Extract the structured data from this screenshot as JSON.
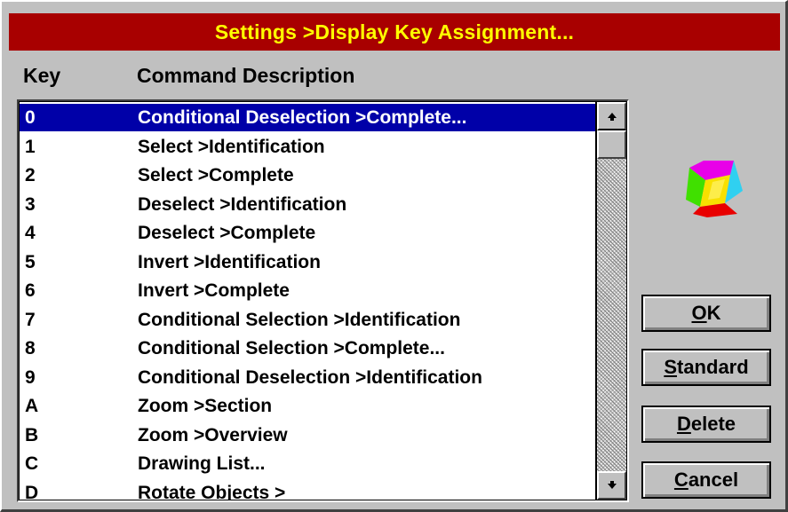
{
  "title": "Settings >Display Key Assignment...",
  "columns": {
    "key": "Key",
    "description": "Command Description"
  },
  "rows": [
    {
      "key": "0",
      "desc": "Conditional Deselection >Complete...",
      "selected": true
    },
    {
      "key": "1",
      "desc": "Select >Identification"
    },
    {
      "key": "2",
      "desc": "Select >Complete"
    },
    {
      "key": "3",
      "desc": "Deselect >Identification"
    },
    {
      "key": "4",
      "desc": "Deselect >Complete"
    },
    {
      "key": "5",
      "desc": "Invert >Identification"
    },
    {
      "key": "6",
      "desc": "Invert >Complete"
    },
    {
      "key": "7",
      "desc": "Conditional Selection >Identification"
    },
    {
      "key": "8",
      "desc": "Conditional Selection >Complete..."
    },
    {
      "key": "9",
      "desc": "Conditional Deselection >Identification"
    },
    {
      "key": "A",
      "desc": "Zoom >Section"
    },
    {
      "key": "B",
      "desc": "Zoom >Overview"
    },
    {
      "key": "C",
      "desc": "Drawing List..."
    },
    {
      "key": "D",
      "desc": "Rotate Objects >"
    }
  ],
  "buttons": {
    "ok": {
      "mnemonic": "O",
      "rest": "K"
    },
    "standard": {
      "mnemonic": "S",
      "rest": "tandard"
    },
    "delete": {
      "mnemonic": "D",
      "rest": "elete"
    },
    "cancel": {
      "mnemonic": "C",
      "rest": "ancel"
    }
  },
  "colors": {
    "titlebar": "#a80000",
    "title_text": "#ffff00",
    "selection": "#0000a8",
    "face": "#c0c0c0"
  },
  "icons": {
    "scroll_up": "arrow-up-icon",
    "scroll_down": "arrow-down-icon",
    "logo": "app-cube-logo-icon"
  }
}
